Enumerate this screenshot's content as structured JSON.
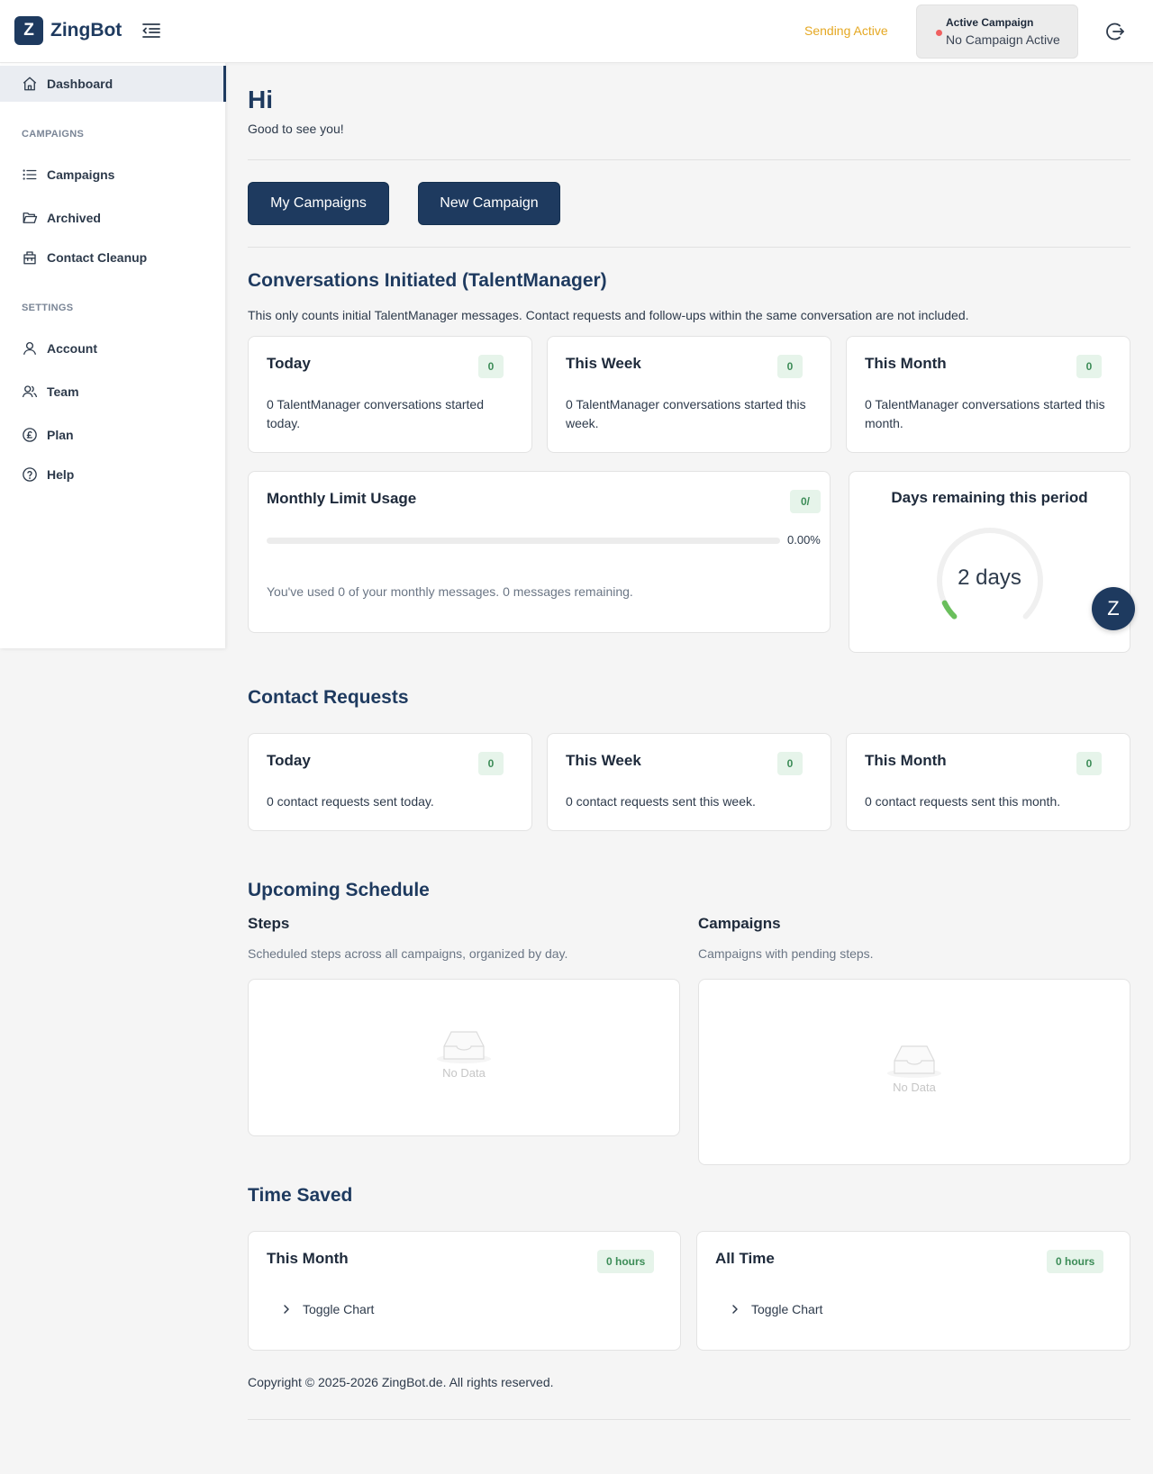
{
  "app": {
    "logo_letter": "Z",
    "name": "ZingBot"
  },
  "header": {
    "sending_status": "Sending Active",
    "active_campaign_label": "Active Campaign",
    "active_campaign_value": "No Campaign Active"
  },
  "sidebar": {
    "dashboard": "Dashboard",
    "campaigns_section": "CAMPAIGNS",
    "campaigns": "Campaigns",
    "archived": "Archived",
    "contact_cleanup": "Contact Cleanup",
    "settings_section": "SETTINGS",
    "account": "Account",
    "team": "Team",
    "plan": "Plan",
    "help": "Help"
  },
  "greeting": {
    "title": "Hi",
    "subtitle": "Good to see you!"
  },
  "buttons": {
    "my_campaigns": "My Campaigns",
    "new_campaign": "New Campaign"
  },
  "conversations": {
    "title": "Conversations Initiated (TalentManager)",
    "description": "This only counts initial TalentManager messages. Contact requests and follow-ups within the same conversation are not included.",
    "cards": [
      {
        "title": "Today",
        "badge": "0",
        "text": "0 TalentManager conversations started today."
      },
      {
        "title": "This Week",
        "badge": "0",
        "text": "0 TalentManager conversations started this week."
      },
      {
        "title": "This Month",
        "badge": "0",
        "text": "0 TalentManager conversations started this month."
      }
    ]
  },
  "monthly_limit": {
    "title": "Monthly Limit Usage",
    "badge": "0/",
    "progress": 0,
    "percent_text": "0.00%",
    "text": "You've used 0 of your monthly messages. 0 messages remaining."
  },
  "days_remaining": {
    "title": "Days remaining this period",
    "value": "2 days",
    "fraction": 0.07
  },
  "contact_requests": {
    "title": "Contact Requests",
    "cards": [
      {
        "title": "Today",
        "badge": "0",
        "text": "0 contact requests sent today."
      },
      {
        "title": "This Week",
        "badge": "0",
        "text": "0 contact requests sent this week."
      },
      {
        "title": "This Month",
        "badge": "0",
        "text": "0 contact requests sent this month."
      }
    ]
  },
  "schedule": {
    "title": "Upcoming Schedule",
    "steps_title": "Steps",
    "steps_desc": "Scheduled steps across all campaigns, organized by day.",
    "campaigns_title": "Campaigns",
    "campaigns_desc": "Campaigns with pending steps.",
    "no_data": "No Data"
  },
  "time_saved": {
    "title": "Time Saved",
    "cards": [
      {
        "title": "This Month",
        "badge": "0 hours",
        "toggle": "Toggle Chart"
      },
      {
        "title": "All Time",
        "badge": "0 hours",
        "toggle": "Toggle Chart"
      }
    ]
  },
  "footer": {
    "text": "Copyright © 2025-2026 ZingBot.de. All rights reserved."
  },
  "fab": {
    "letter": "Z"
  },
  "colors": {
    "primary": "#1e3a5f",
    "warning": "#e5a823",
    "success": "#3c8c57",
    "accent_green": "#6abf5c",
    "danger_dot": "#f06060"
  }
}
